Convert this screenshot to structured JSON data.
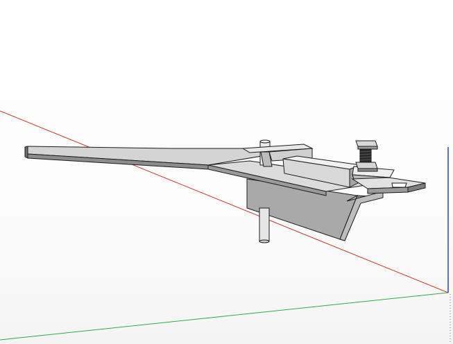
{
  "viewport": {
    "background": "#ffffff"
  },
  "axes": {
    "red_axis_color": "#c0392b",
    "green_axis_color": "#2ea84a",
    "blue_axis_color": "#2b3fd6"
  },
  "model": {
    "steel_light": "#d9d9d9",
    "steel_mid": "#b5b5b5",
    "steel_dark": "#7f7f7f",
    "edge": "#1a1a1a",
    "bolt": "#2a2a2a",
    "angle_iron": "#a8a8a8"
  }
}
